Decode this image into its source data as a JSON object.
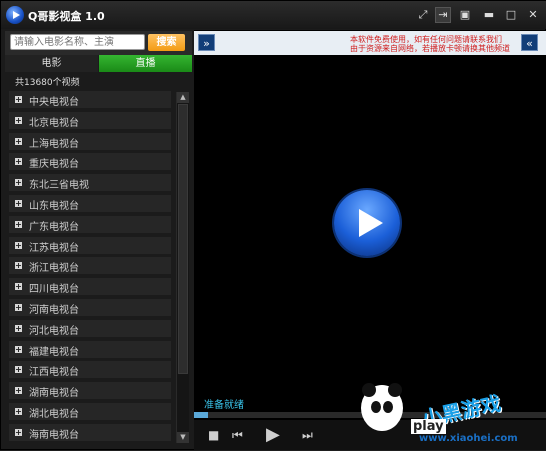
{
  "app": {
    "title": "Q哥影视盒 1.0"
  },
  "search": {
    "placeholder": "请输入电影名称、主演",
    "button_label": "搜索"
  },
  "tabs": [
    {
      "label": "电影",
      "active": false
    },
    {
      "label": "直播",
      "active": true
    }
  ],
  "video_count": "共13680个视频",
  "channels": [
    "中央电视台",
    "北京电视台",
    "上海电视台",
    "重庆电视台",
    "东北三省电视",
    "山东电视台",
    "广东电视台",
    "江苏电视台",
    "浙江电视台",
    "四川电视台",
    "河南电视台",
    "河北电视台",
    "福建电视台",
    "江西电视台",
    "湖南电视台",
    "湖北电视台",
    "海南电视台"
  ],
  "player": {
    "marquee_line1": "本软件免费使用，如有任何问题请联系我们",
    "marquee_line2": "由于资源来自网络，若播放卡顿请换其他频道",
    "status": "准备就绪",
    "progress": 0.04
  },
  "watermark": {
    "text": "小黑游戏",
    "play": "play",
    "url": "www.xiaohei.com"
  },
  "colors": {
    "accent_green": "#2aa827",
    "search_orange": "#f39b13",
    "status_cyan": "#39c2e8"
  }
}
